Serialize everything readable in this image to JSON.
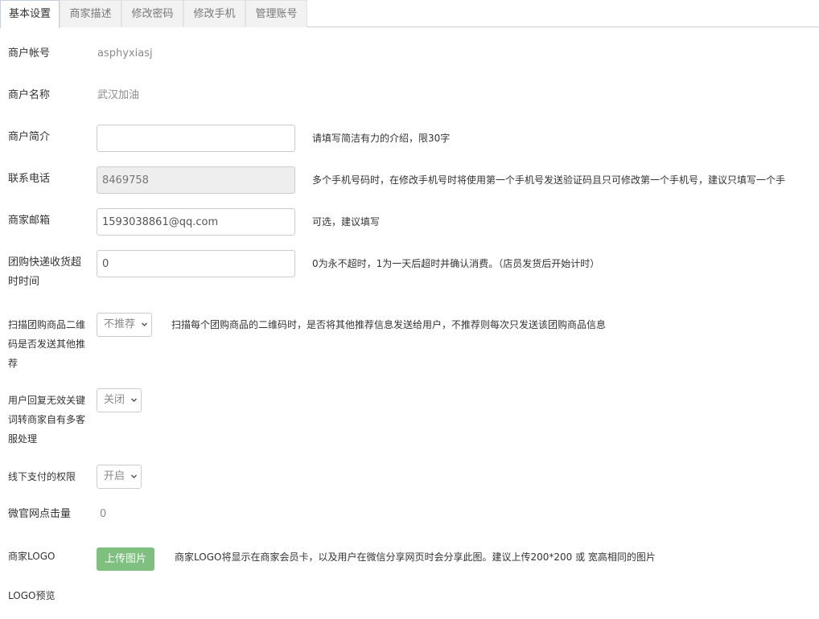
{
  "tabs": [
    "基本设置",
    "商家描述",
    "修改密码",
    "修改手机",
    "管理账号"
  ],
  "account": {
    "label": "商户帐号",
    "value": "asphyxiasj"
  },
  "name": {
    "label": "商户名称",
    "value": "武汉加油"
  },
  "intro": {
    "label": "商户简介",
    "value": "",
    "help": "请填写简洁有力的介绍，限30字"
  },
  "phone": {
    "label": "联系电话",
    "value": "8469758",
    "help": "多个手机号码时，在修改手机号时将使用第一个手机号发送验证码且只可修改第一个手机号，建议只填写一个手"
  },
  "email": {
    "label": "商家邮箱",
    "value": "1593038861@qq.com",
    "help": "可选，建议填写"
  },
  "timeout": {
    "label_lines": [
      "团购快递收货超",
      "时时间"
    ],
    "value": "0",
    "help": "0为永不超时，1为一天后超时并确认消费。（店员发货后开始计时）"
  },
  "qrcode": {
    "label_lines": [
      "扫描团购商品二维",
      "码是否发送其他推",
      "荐"
    ],
    "selected": "不推荐",
    "help": "扫描每个团购商品的二维码时，是否将其他推荐信息发送给用户，不推荐则每次只发送该团购商品信息"
  },
  "invalid_kw": {
    "label_lines": [
      "用户回复无效关键",
      "词转商家自有多客",
      "服处理"
    ],
    "selected": "关闭"
  },
  "offline_pay": {
    "label": "线下支付的权限",
    "selected": "开启"
  },
  "clicks": {
    "label": "微官网点击量",
    "value": "0"
  },
  "logo": {
    "label": "商家LOGO",
    "button": "上传图片",
    "help": "商家LOGO将显示在商家会员卡，以及用户在微信分享网页时会分享此图。建议上传200*200 或 宽高相同的图片",
    "preview_label": "LOGO预览"
  },
  "colors": {
    "accent_border": "#c8cedd",
    "button_green": "#7fbf7f",
    "disabled_bg": "#eeeeee"
  },
  "icons": {
    "select_arrow": "chevron-down-icon"
  }
}
